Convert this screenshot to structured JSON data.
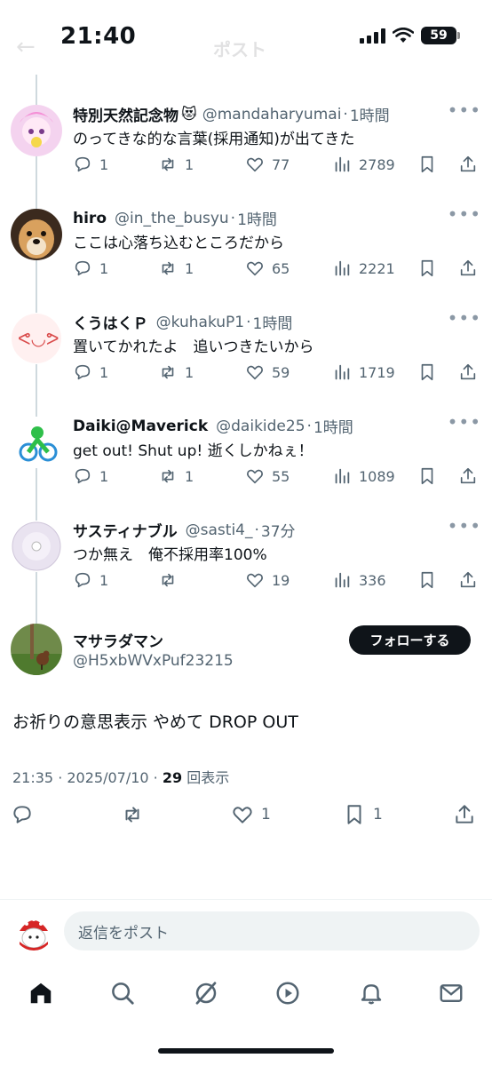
{
  "status_bar": {
    "time": "21:40",
    "battery": "59"
  },
  "nav": {
    "title": "ポスト"
  },
  "replies": [
    {
      "name": "特別天然記念物",
      "emoji": "😻",
      "handle": "@mandaharyumai",
      "time": "1時間",
      "text": "のってきな的な言葉(採用通知)が出てきた",
      "replies": "1",
      "reposts": "1",
      "likes": "77",
      "views": "2789"
    },
    {
      "name": "hiro",
      "emoji": "",
      "handle": "@in_the_busyu",
      "time": "1時間",
      "text": "ここは心落ち込むところだから",
      "replies": "1",
      "reposts": "1",
      "likes": "65",
      "views": "2221"
    },
    {
      "name": "くうはくＰ",
      "emoji": "",
      "handle": "@kuhakuP1",
      "time": "1時間",
      "text": "置いてかれたよ　追いつきたいから",
      "replies": "1",
      "reposts": "1",
      "likes": "59",
      "views": "1719"
    },
    {
      "name": "Daiki@Maverick",
      "emoji": "",
      "handle": "@daikide25",
      "time": "1時間",
      "text": "get out!  Shut up! 逝くしかねぇ！",
      "replies": "1",
      "reposts": "1",
      "likes": "55",
      "views": "1089"
    },
    {
      "name": "サスティナブル",
      "emoji": "",
      "handle": "@sasti4_",
      "time": "37分",
      "text": "つか無え　俺不採用率100%",
      "replies": "1",
      "reposts": "",
      "likes": "19",
      "views": "336"
    }
  ],
  "main_post": {
    "name": "マサラダマン",
    "handle": "@H5xbWVxPuf23215",
    "follow_label": "フォローする",
    "text": "お祈りの意思表示 やめて DROP OUT",
    "timestamp": "21:35 · 2025/07/10 · ",
    "view_count": "29",
    "view_label": " 回表示",
    "likes": "1",
    "bookmarks": "1"
  },
  "reply_box": {
    "placeholder": "返信をポスト"
  },
  "colors": {
    "text": "#0f1419",
    "secondary": "#536471",
    "divider": "#eff3f4",
    "accent": "#1d9bf0"
  }
}
